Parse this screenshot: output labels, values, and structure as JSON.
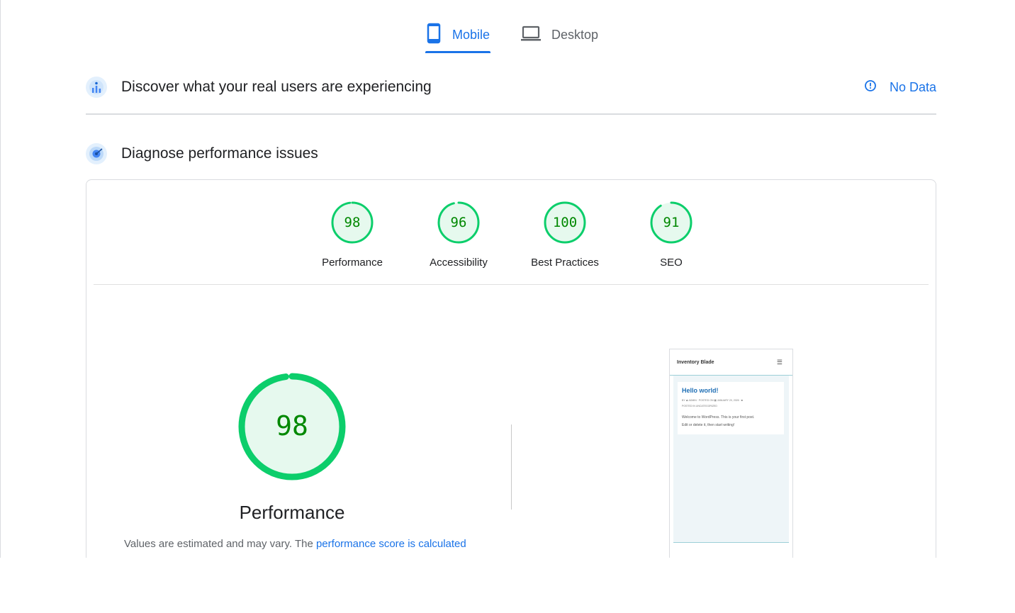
{
  "tabs": {
    "mobile_label": "Mobile",
    "desktop_label": "Desktop",
    "active": "Mobile"
  },
  "crux": {
    "title": "Discover what your real users are experiencing",
    "no_data_label": "No Data"
  },
  "diagnose": {
    "title": "Diagnose performance issues"
  },
  "categories": [
    {
      "score": "98",
      "label": "Performance"
    },
    {
      "score": "96",
      "label": "Accessibility"
    },
    {
      "score": "100",
      "label": "Best Practices"
    },
    {
      "score": "91",
      "label": "SEO"
    }
  ],
  "performance": {
    "score": "98",
    "title": "Performance",
    "disclaimer_prefix": "Values are estimated and may vary. The ",
    "disclaimer_link": "performance score is calculated"
  },
  "screenshot": {
    "site_title": "Inventory Blade",
    "post_title": "Hello world!",
    "post_meta_1": "BY ♟ ADMIN · POSTED ON ▦ JANUARY 20, 2026 · ■",
    "post_meta_2": "POSTED IN UNCATEGORIZED",
    "post_text_1": "Welcome to WordPress. This is your first post.",
    "post_text_2": "Edit or delete it, then start writing!"
  },
  "colors": {
    "accent": "#1a73e8",
    "pass_green": "#0cce6b",
    "pass_fill": "#e6f9ee",
    "pass_text": "#008800"
  },
  "icons": {
    "mobile_tab": "smartphone-icon",
    "desktop_tab": "laptop-icon",
    "crux_section": "users-chart-icon",
    "diagnose_section": "lighthouse-target-icon",
    "no_data": "info-icon",
    "thumb_menu": "hamburger-menu-icon"
  }
}
